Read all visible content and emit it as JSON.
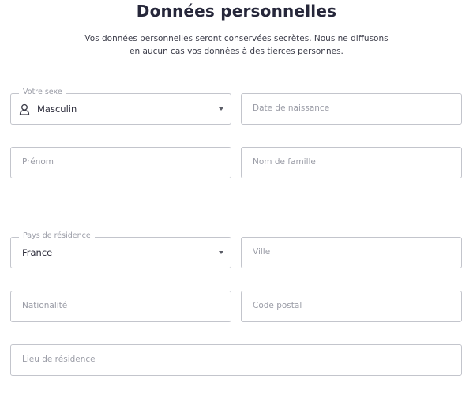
{
  "header": {
    "title": "Données personnelles",
    "subtitle_line1": "Vos données personnelles seront conservées secrètes. Nous ne diffusons",
    "subtitle_line2": "en aucun cas vos données à des tierces personnes."
  },
  "form": {
    "sexe": {
      "label": "Votre sexe",
      "value": "Masculin",
      "icon": "person-icon"
    },
    "date_naissance": {
      "placeholder": "Date de naissance"
    },
    "prenom": {
      "placeholder": "Prénom"
    },
    "nom_famille": {
      "placeholder": "Nom de famille"
    },
    "pays": {
      "label": "Pays de résidence",
      "value": "France"
    },
    "ville": {
      "placeholder": "Ville"
    },
    "nationalite": {
      "placeholder": "Nationalité"
    },
    "code_postal": {
      "placeholder": "Code postal"
    },
    "lieu_residence": {
      "placeholder": "Lieu de résidence"
    }
  },
  "colors": {
    "border": "#c3c5cc",
    "placeholder": "#9a9ca6",
    "text": "#2b2b3a",
    "divider": "#e6e7ea"
  }
}
